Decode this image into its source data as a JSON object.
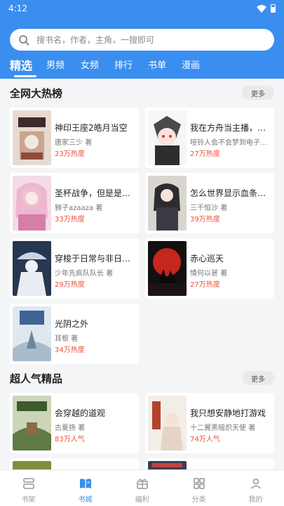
{
  "status": {
    "time": "4:12"
  },
  "search": {
    "placeholder": "搜书名，作者，主角，一搜即可"
  },
  "tabs": [
    {
      "label": "精选",
      "active": true
    },
    {
      "label": "男频"
    },
    {
      "label": "女频"
    },
    {
      "label": "排行"
    },
    {
      "label": "书单"
    },
    {
      "label": "漫画"
    }
  ],
  "hot": {
    "title": "全网大热榜",
    "more": "更多",
    "books": [
      {
        "title": "神印王座2皓月当空",
        "author": "唐家三少 著",
        "heat": "23万热度"
      },
      {
        "title": "我在方舟当主播，不…",
        "author": "哑铃人会不会梦到电子歌…",
        "heat": "27万热度"
      },
      {
        "title": "圣杯战争，但是是神…",
        "author": "狮子azaaza 著",
        "heat": "33万热度"
      },
      {
        "title": "怎么世界显示血条了…",
        "author": "三千恒沙 著",
        "heat": "39万热度"
      },
      {
        "title": "穿梭于日常与非日常…",
        "author": "少年先疯队队长 著",
        "heat": "29万热度"
      },
      {
        "title": "赤心巡天",
        "author": "情何以甚 著",
        "heat": "27万热度"
      },
      {
        "title": "光阴之外",
        "author": "耳根 著",
        "heat": "34万热度"
      }
    ]
  },
  "popular": {
    "title": "超人气精品",
    "more": "更多",
    "books": [
      {
        "title": "会穿越的道观",
        "author": "古夏扬 著",
        "heat": "83万人气"
      },
      {
        "title": "我只想安静地打游戏",
        "author": "十二翼黑暗炽天使 著",
        "heat": "74万人气"
      }
    ]
  },
  "nav": [
    {
      "label": "书架",
      "icon": "bookshelf-icon"
    },
    {
      "label": "书城",
      "icon": "book-city-icon",
      "active": true
    },
    {
      "label": "福利",
      "icon": "gift-icon"
    },
    {
      "label": "分类",
      "icon": "category-icon"
    },
    {
      "label": "我的",
      "icon": "profile-icon"
    }
  ],
  "colors": {
    "brand": "#3a8ef0",
    "heat": "#ee4f3b"
  }
}
